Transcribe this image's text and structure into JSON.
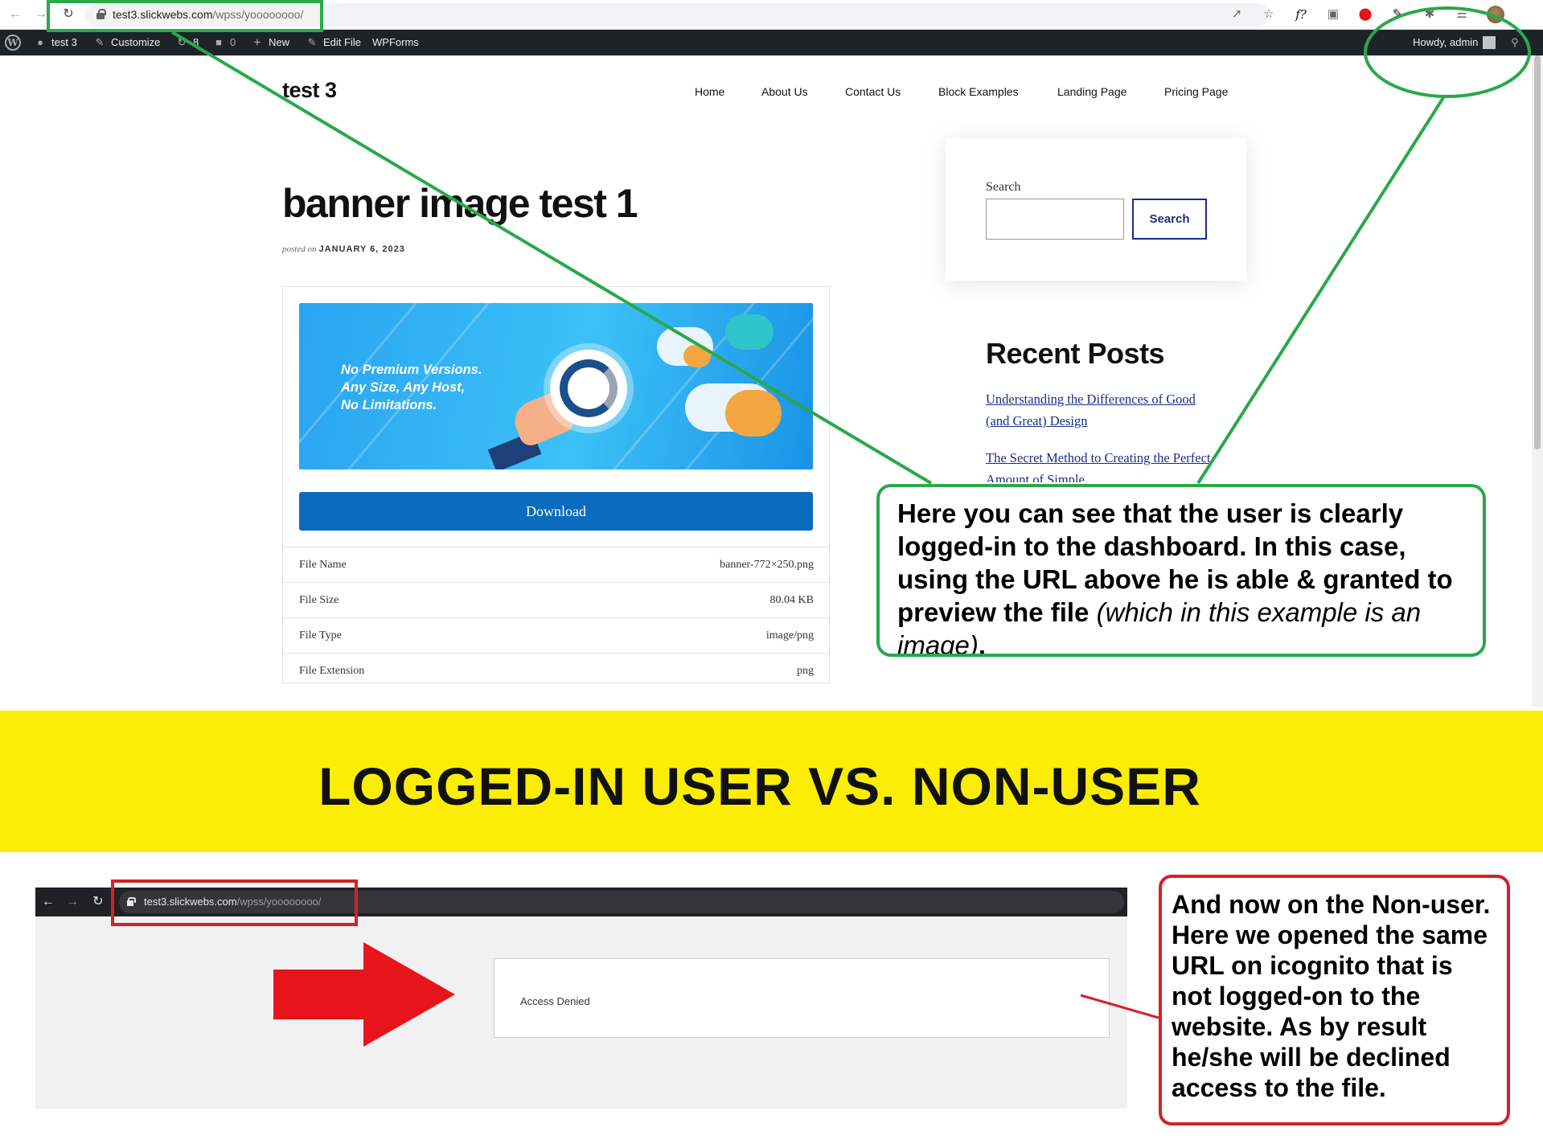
{
  "browser": {
    "url_host": "test3.slickwebs.com",
    "url_path": "/wpss/yoooooooo/"
  },
  "admin_bar": {
    "site_name": "test 3",
    "customize": "Customize",
    "updates_count": "8",
    "comments_count": "0",
    "new": "New",
    "edit_file": "Edit File",
    "wpforms": "WPForms",
    "howdy": "Howdy, admin"
  },
  "site": {
    "title": "test 3",
    "nav": [
      "Home",
      "About Us",
      "Contact Us",
      "Block Examples",
      "Landing Page",
      "Pricing Page"
    ]
  },
  "post": {
    "title": "banner image test 1",
    "meta_label": "posted on",
    "date": "JANUARY 6, 2023",
    "banner_text": "No Premium Versions.\nAny Size, Any Host,\nNo Limitations.",
    "download_label": "Download",
    "file_rows": [
      {
        "key": "File Name",
        "value": "banner-772×250.png"
      },
      {
        "key": "File Size",
        "value": "80.04 KB"
      },
      {
        "key": "File Type",
        "value": "image/png"
      },
      {
        "key": "File Extension",
        "value": "png"
      }
    ]
  },
  "sidebar": {
    "search_label": "Search",
    "search_button": "Search",
    "recent_title": "Recent Posts",
    "recent_posts": [
      "Understanding the Differences of Good (and Great) Design",
      "The Secret Method to Creating the Perfect Amount of Simple"
    ]
  },
  "green_note": {
    "text_bold": "Here you can see that the user is clearly logged-in to the dashboard. In this case, using the URL above he is able & granted to preview the file ",
    "text_italic": "(which in this example is an image)",
    "text_end": "."
  },
  "banner_title": "LOGGED-IN USER VS. NON-USER",
  "incognito": {
    "url_host": "test3.slickwebs.com",
    "url_path": "/wpss/yoooooooo/",
    "denied_text": "Access Denied"
  },
  "red_note": {
    "text": "And now on the Non-user. Here we opened the same URL on icognito that is not logged-on to the website. As by result he/she will be declined access to the file."
  },
  "colors": {
    "annotation_green": "#2aa84a",
    "annotation_red": "#d62027",
    "banner_yellow": "#fbee04",
    "download_blue": "#0b6bbd",
    "admin_bar": "#1d2327"
  }
}
